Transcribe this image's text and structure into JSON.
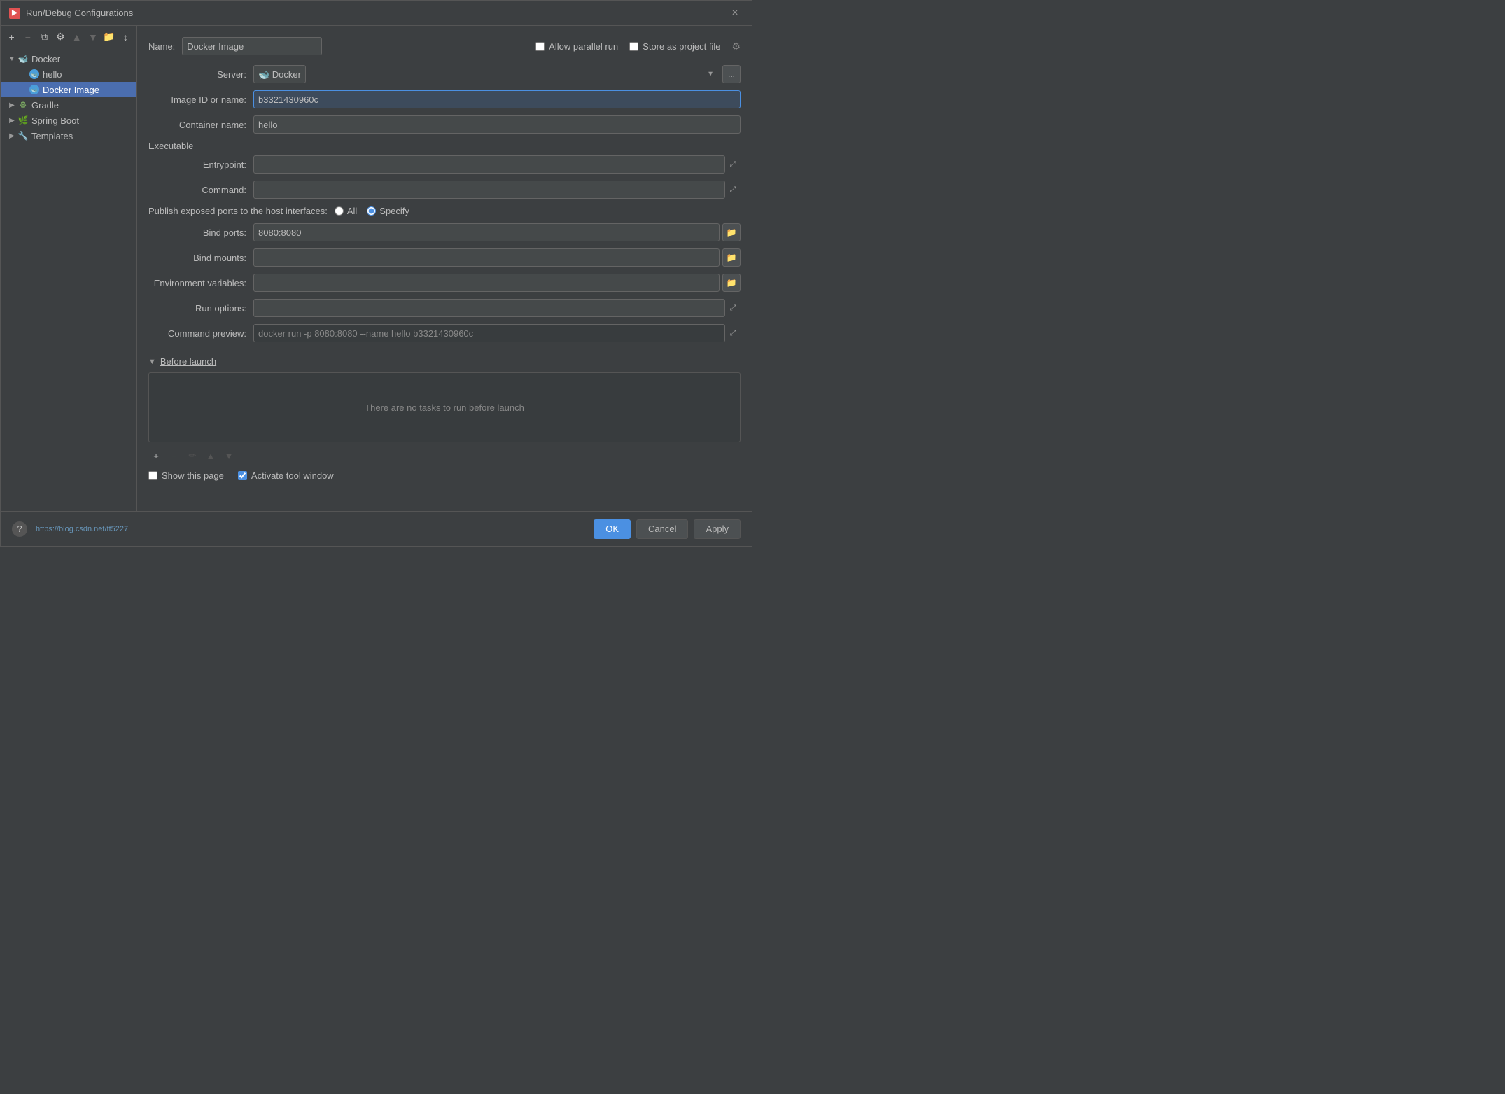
{
  "dialog": {
    "title": "Run/Debug Configurations",
    "close_label": "×"
  },
  "toolbar": {
    "add_label": "+",
    "remove_label": "−",
    "copy_label": "⧉",
    "settings_label": "⚙",
    "move_up_label": "▲",
    "move_down_label": "▼",
    "folder_label": "📁",
    "sort_label": "↕"
  },
  "tree": {
    "items": [
      {
        "id": "docker",
        "label": "Docker",
        "level": 0,
        "expanded": true,
        "icon": "docker"
      },
      {
        "id": "hello",
        "label": "hello",
        "level": 1,
        "expanded": false,
        "icon": "docker-item"
      },
      {
        "id": "docker-image",
        "label": "Docker Image",
        "level": 1,
        "expanded": false,
        "icon": "docker-item",
        "selected": true
      },
      {
        "id": "gradle",
        "label": "Gradle",
        "level": 0,
        "expanded": false,
        "icon": "gradle"
      },
      {
        "id": "spring-boot",
        "label": "Spring Boot",
        "level": 0,
        "expanded": false,
        "icon": "spring"
      },
      {
        "id": "templates",
        "label": "Templates",
        "level": 0,
        "expanded": false,
        "icon": "wrench"
      }
    ]
  },
  "form": {
    "name_label": "Name:",
    "name_value": "Docker Image",
    "allow_parallel_label": "Allow parallel run",
    "store_project_label": "Store as project file",
    "server_label": "Server:",
    "server_value": "Docker",
    "server_browse_label": "...",
    "image_id_label": "Image ID or name:",
    "image_id_value": "b3321430960c",
    "container_name_label": "Container name:",
    "container_name_value": "hello",
    "executable_label": "Executable",
    "entrypoint_label": "Entrypoint:",
    "entrypoint_value": "",
    "command_label": "Command:",
    "command_value": "",
    "publish_ports_label": "Publish exposed ports to the host interfaces:",
    "radio_all_label": "All",
    "radio_specify_label": "Specify",
    "bind_ports_label": "Bind ports:",
    "bind_ports_value": "8080:8080",
    "bind_mounts_label": "Bind mounts:",
    "bind_mounts_value": "",
    "env_vars_label": "Environment variables:",
    "env_vars_value": "",
    "run_options_label": "Run options:",
    "run_options_value": "",
    "command_preview_label": "Command preview:",
    "command_preview_value": "docker run -p 8080:8080 --name hello b3321430960c",
    "before_launch_label": "Before launch",
    "before_launch_empty": "There are no tasks to run before launch",
    "show_page_label": "Show this page",
    "activate_tool_label": "Activate tool window"
  },
  "footer": {
    "help_link": "https://blog.csdn.net/tt5227",
    "ok_label": "OK",
    "cancel_label": "Cancel",
    "apply_label": "Apply"
  }
}
